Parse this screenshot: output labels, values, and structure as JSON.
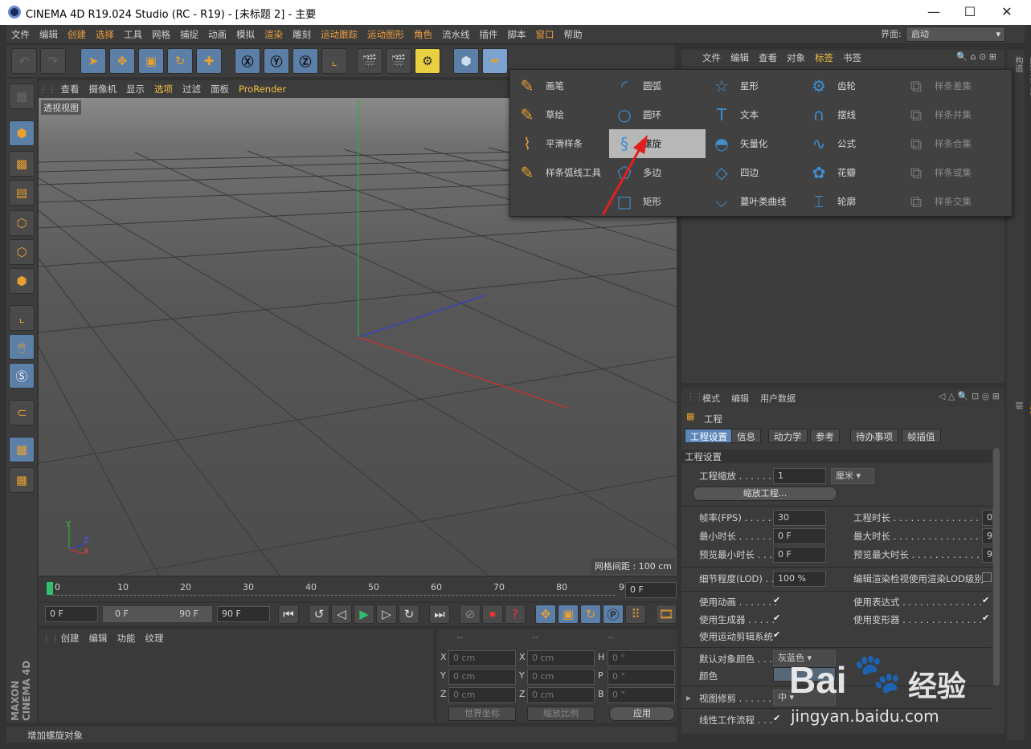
{
  "window": {
    "title": "CINEMA 4D R19.024 Studio (RC - R19) - [未标题 2] - 主要",
    "minimize": "—",
    "maximize": "☐",
    "close": "✕"
  },
  "menubar": {
    "items": [
      "文件",
      "编辑",
      "创建",
      "选择",
      "工具",
      "网格",
      "捕捉",
      "动画",
      "模拟",
      "渲染",
      "雕刻",
      "运动跟踪",
      "运动图形",
      "角色",
      "流水线",
      "插件",
      "脚本",
      "窗口",
      "帮助"
    ],
    "highlight": [
      "创建",
      "选择",
      "渲染",
      "运动跟踪",
      "运动图形",
      "角色",
      "窗口"
    ],
    "layout_label": "界面:",
    "layout_value": "启动"
  },
  "viewport": {
    "menu": [
      "查看",
      "摄像机",
      "显示",
      "选项",
      "过滤",
      "面板",
      "ProRender"
    ],
    "view_label": "透视视图",
    "grid_label": "网格间距 : 100 cm",
    "axis_y": "Y",
    "axis_z": "Z",
    "axis_x": "X"
  },
  "timeline": {
    "ticks": [
      "0",
      "10",
      "20",
      "30",
      "40",
      "50",
      "60",
      "70",
      "80",
      "90"
    ],
    "frame_field": "0 F"
  },
  "playbar": {
    "start": "0 F",
    "range_start": "0 F",
    "range_end": "90 F",
    "end": "90 F"
  },
  "materials": {
    "menu": [
      "创建",
      "编辑",
      "功能",
      "纹理"
    ]
  },
  "coords": {
    "headers": [
      "--",
      "--",
      "--"
    ],
    "rows": [
      {
        "a": "X",
        "v1": "0 cm",
        "b": "X",
        "v2": "0 cm",
        "c": "H",
        "v3": "0 °"
      },
      {
        "a": "Y",
        "v1": "0 cm",
        "b": "Y",
        "v2": "0 cm",
        "c": "P",
        "v3": "0 °"
      },
      {
        "a": "Z",
        "v1": "0 cm",
        "b": "Z",
        "v2": "0 cm",
        "c": "B",
        "v3": "0 °"
      }
    ],
    "world": "世界坐标",
    "scale": "缩放比例",
    "apply": "应用"
  },
  "objects_panel": {
    "tabs": [
      "文件",
      "编辑",
      "查看",
      "对象",
      "标签",
      "书签"
    ]
  },
  "spline_popup": {
    "columns": [
      [
        "画笔",
        "草绘",
        "平滑样条",
        "样条弧线工具"
      ],
      [
        "圆弧",
        "圆环",
        "螺旋",
        "多边",
        "矩形"
      ],
      [
        "星形",
        "文本",
        "矢量化",
        "四边",
        "蔓叶类曲线"
      ],
      [
        "齿轮",
        "摆线",
        "公式",
        "花瓣",
        "轮廓"
      ],
      [
        "样条差集",
        "样条并集",
        "样条合集",
        "样条或集",
        "样条交集"
      ]
    ],
    "selected": "螺旋"
  },
  "attributes": {
    "menu": [
      "模式",
      "编辑",
      "用户数据"
    ],
    "object": "工程",
    "tabs": [
      "工程设置",
      "信息",
      "动力学",
      "参考",
      "待办事项",
      "帧插值"
    ],
    "section": "工程设置",
    "scale_label": "工程缩放 . . . . . . .",
    "scale_value": "1",
    "scale_unit": "厘米",
    "scale_button": "缩放工程...",
    "fps_label": "帧率(FPS) . . . . . .",
    "fps_value": "30",
    "duration_label": "工程时长 . . . . . . . . . . . . . . . .",
    "duration_value": "0",
    "min_label": "最小时长 . . . . . . .",
    "min_value": "0 F",
    "max_label": "最大时长 . . . . . . . . . . . . . . . .",
    "max_value": "9",
    "pmin_label": "预览最小时长 . . .",
    "pmin_value": "0 F",
    "pmax_label": "预览最大时长 . . . . . . . . . . . . .",
    "pmax_value": "9",
    "lod_label": "细节程度(LOD) . .",
    "lod_value": "100 %",
    "lod_render": "编辑渲染检视使用渲染LOD级别",
    "use_anim": "使用动画 . . . . . . .",
    "use_expr": "使用表达式 . . . . . . . . . . . . . .",
    "use_gen": "使用生成器 . . . . .",
    "use_deform": "使用变形器 . . . . . . . . . . . . . .",
    "use_motion": "使用运动剪辑系统",
    "def_color_label": "默认对象颜色 . . .",
    "def_color_value": "灰蓝色",
    "color_label": "颜色",
    "view_clip_label": "视图修剪 . . . . . . .",
    "view_clip_value": "中",
    "linear_label": "线性工作流程 . . ."
  },
  "side_tabs": [
    "对象",
    "场次",
    "内容浏览器",
    "构造"
  ],
  "side_tabs2": [
    "属性",
    "层"
  ],
  "status": "增加螺旋对象",
  "watermark": {
    "brand": "Bai",
    "paw": "🐾",
    "suffix": "经验",
    "url": "jingyan.baidu.com"
  }
}
